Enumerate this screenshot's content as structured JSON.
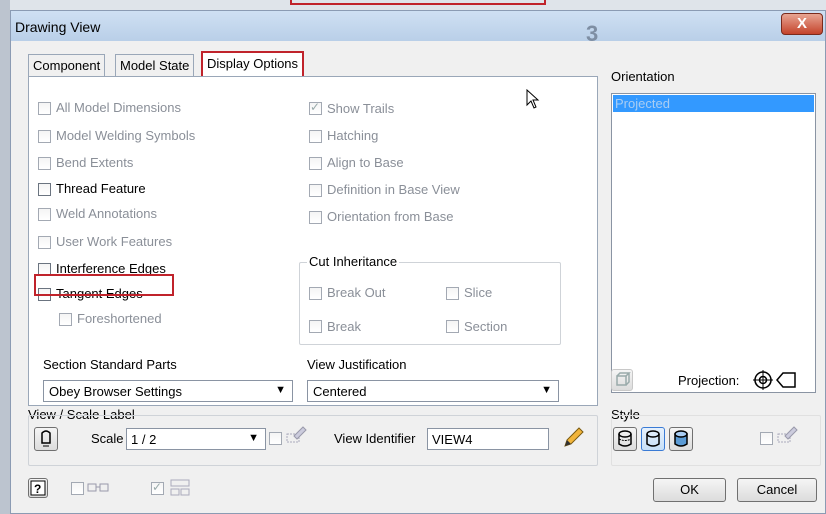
{
  "dialog": {
    "title": "Drawing View",
    "close_glyph": "X",
    "background_digit": "3"
  },
  "tabs": [
    {
      "label": "Component"
    },
    {
      "label": "Model State"
    },
    {
      "label": "Display Options"
    }
  ],
  "left_options": [
    "All Model Dimensions",
    "Model Welding Symbols",
    "Bend Extents",
    "Thread Feature",
    "Weld Annotations",
    "User Work Features",
    "Interference Edges",
    "Tangent Edges",
    "Foreshortened"
  ],
  "right_options": [
    "Show Trails",
    "Hatching",
    "Align to Base",
    "Definition in Base View",
    "Orientation from Base"
  ],
  "cut_inheritance": {
    "title": "Cut Inheritance",
    "items": [
      "Break Out",
      "Slice",
      "Break",
      "Section"
    ]
  },
  "section_standard_parts": {
    "label": "Section Standard Parts",
    "value": "Obey Browser Settings"
  },
  "view_justification": {
    "label": "View Justification",
    "value": "Centered"
  },
  "orientation": {
    "label": "Orientation",
    "selected": "Projected"
  },
  "projection": {
    "label": "Projection:"
  },
  "view_scale": {
    "group_label": "View / Scale Label",
    "scale_label": "Scale",
    "scale_value": "1 / 2",
    "identifier_label": "View Identifier",
    "identifier_value": "VIEW4"
  },
  "style": {
    "label": "Style"
  },
  "buttons": {
    "ok": "OK",
    "cancel": "Cancel"
  },
  "colors": {
    "highlight": "#c0232b",
    "selection": "#3399ff"
  }
}
